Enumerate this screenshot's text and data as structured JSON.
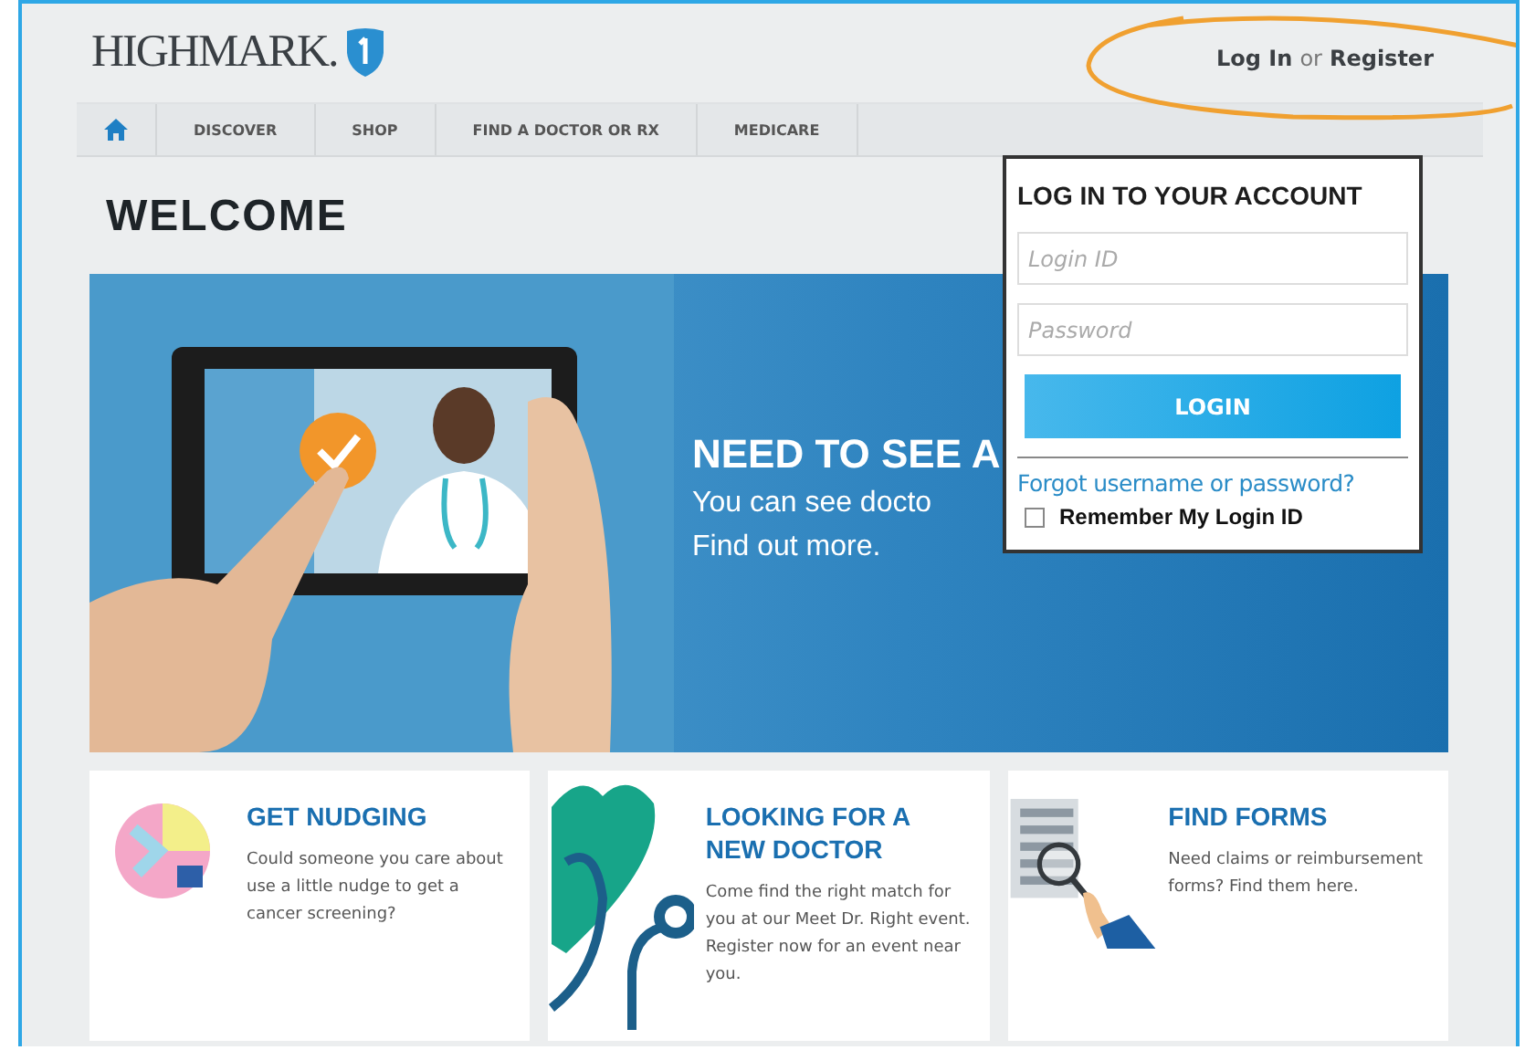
{
  "header": {
    "logo": "HIGHMARK.",
    "login_link": "Log In",
    "separator": "or",
    "register_link": "Register"
  },
  "nav": {
    "items": [
      {
        "label": "DISCOVER"
      },
      {
        "label": "SHOP"
      },
      {
        "label": "FIND A DOCTOR OR RX"
      },
      {
        "label": "MEDICARE"
      }
    ]
  },
  "page_title": "WELCOME",
  "hero": {
    "headline": "NEED TO SEE A",
    "lines": [
      "You can see docto",
      "Find out more."
    ]
  },
  "login_panel": {
    "title": "LOG IN TO YOUR ACCOUNT",
    "login_id": {
      "placeholder": "Login ID"
    },
    "password": {
      "placeholder": "Password"
    },
    "button": "LOGIN",
    "forgot_link": "Forgot username or password?",
    "remember": {
      "label": "Remember My Login ID",
      "checked": false
    }
  },
  "cards": [
    {
      "kind": "nudge",
      "title": [
        "GET NUDGING"
      ],
      "text": "Could someone you care about use a little nudge to get a cancer screening?"
    },
    {
      "kind": "doctor",
      "title": [
        "LOOKING FOR A",
        "NEW DOCTOR"
      ],
      "text": "Come find the right match for you at our Meet Dr. Right event. Register now for an event near you."
    },
    {
      "kind": "forms",
      "title": [
        "FIND FORMS"
      ],
      "text": "Need claims or reimbursement forms? Find them here."
    }
  ]
}
